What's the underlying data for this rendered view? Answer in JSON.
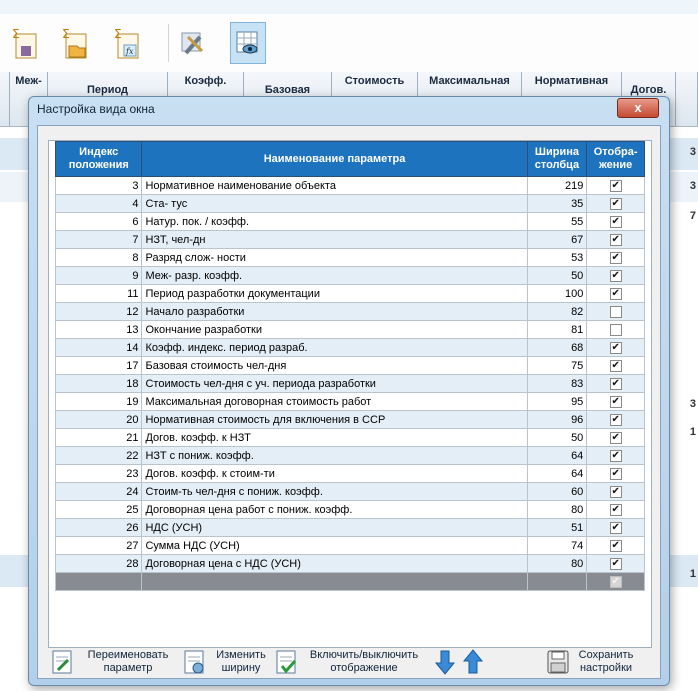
{
  "background_grid": {
    "columns": [
      "Меж-",
      "Период",
      "Коэфф.",
      "Базовая",
      "Стоимость",
      "Максимальная",
      "Нормативная",
      "Догов."
    ],
    "side_values": [
      "3",
      "3",
      "7",
      "3",
      "1",
      "1"
    ]
  },
  "toolbar": {
    "icons": [
      "sigma-save-icon",
      "sigma-folder-icon",
      "sigma-formula-icon",
      "tools-icon",
      "view-settings-icon"
    ]
  },
  "dialog": {
    "title": "Настройка вида окна",
    "close_label": "x",
    "table": {
      "headers": {
        "index": "Индекс положения",
        "name": "Наименование параметра",
        "width": "Ширина столбца",
        "display": "Отобра-жение"
      },
      "rows": [
        {
          "index": "3",
          "name": "Нормативное наименование объекта",
          "width": "219",
          "checked": true
        },
        {
          "index": "4",
          "name": "Ста- тус",
          "width": "35",
          "checked": true
        },
        {
          "index": "6",
          "name": "Натур. пок. / коэфф.",
          "width": "55",
          "checked": true
        },
        {
          "index": "7",
          "name": "НЗТ, чел-дн",
          "width": "67",
          "checked": true
        },
        {
          "index": "8",
          "name": "Разряд слож- ности",
          "width": "53",
          "checked": true
        },
        {
          "index": "9",
          "name": "Меж- разр. коэфф.",
          "width": "50",
          "checked": true
        },
        {
          "index": "11",
          "name": "Период разработки документации",
          "width": "100",
          "checked": true
        },
        {
          "index": "12",
          "name": "Начало разработки",
          "width": "82",
          "checked": false
        },
        {
          "index": "13",
          "name": "Окончание разработки",
          "width": "81",
          "checked": false
        },
        {
          "index": "14",
          "name": "Коэфф. индекс. период разраб.",
          "width": "68",
          "checked": true
        },
        {
          "index": "17",
          "name": "Базовая стоимость чел-дня",
          "width": "75",
          "checked": true
        },
        {
          "index": "18",
          "name": "Стоимость чел-дня с уч. периода разработки",
          "width": "83",
          "checked": true
        },
        {
          "index": "19",
          "name": "Максимальная договорная стоимость работ",
          "width": "95",
          "checked": true
        },
        {
          "index": "20",
          "name": "Нормативная стоимость для включения в ССР",
          "width": "96",
          "checked": true
        },
        {
          "index": "21",
          "name": "Догов. коэфф. к НЗТ",
          "width": "50",
          "checked": true
        },
        {
          "index": "22",
          "name": "НЗТ с пониж. коэфф.",
          "width": "64",
          "checked": true
        },
        {
          "index": "23",
          "name": "Догов. коэфф. к стоим-ти",
          "width": "64",
          "checked": true
        },
        {
          "index": "24",
          "name": "Стоим-ть чел-дня с пониж. коэфф.",
          "width": "60",
          "checked": true
        },
        {
          "index": "25",
          "name": "Договорная цена работ с пониж. коэфф.",
          "width": "80",
          "checked": true
        },
        {
          "index": "26",
          "name": "НДС (УСН)",
          "width": "51",
          "checked": true
        },
        {
          "index": "27",
          "name": "Сумма НДС (УСН)",
          "width": "74",
          "checked": true
        },
        {
          "index": "28",
          "name": "Договорная цена с НДС (УСН)",
          "width": "80",
          "checked": true
        }
      ]
    },
    "footer": {
      "rename": "Переименовать параметр",
      "change_width": "Изменить ширину",
      "toggle_display": "Включить/выключить отображение",
      "save": "Сохранить настройки"
    }
  }
}
